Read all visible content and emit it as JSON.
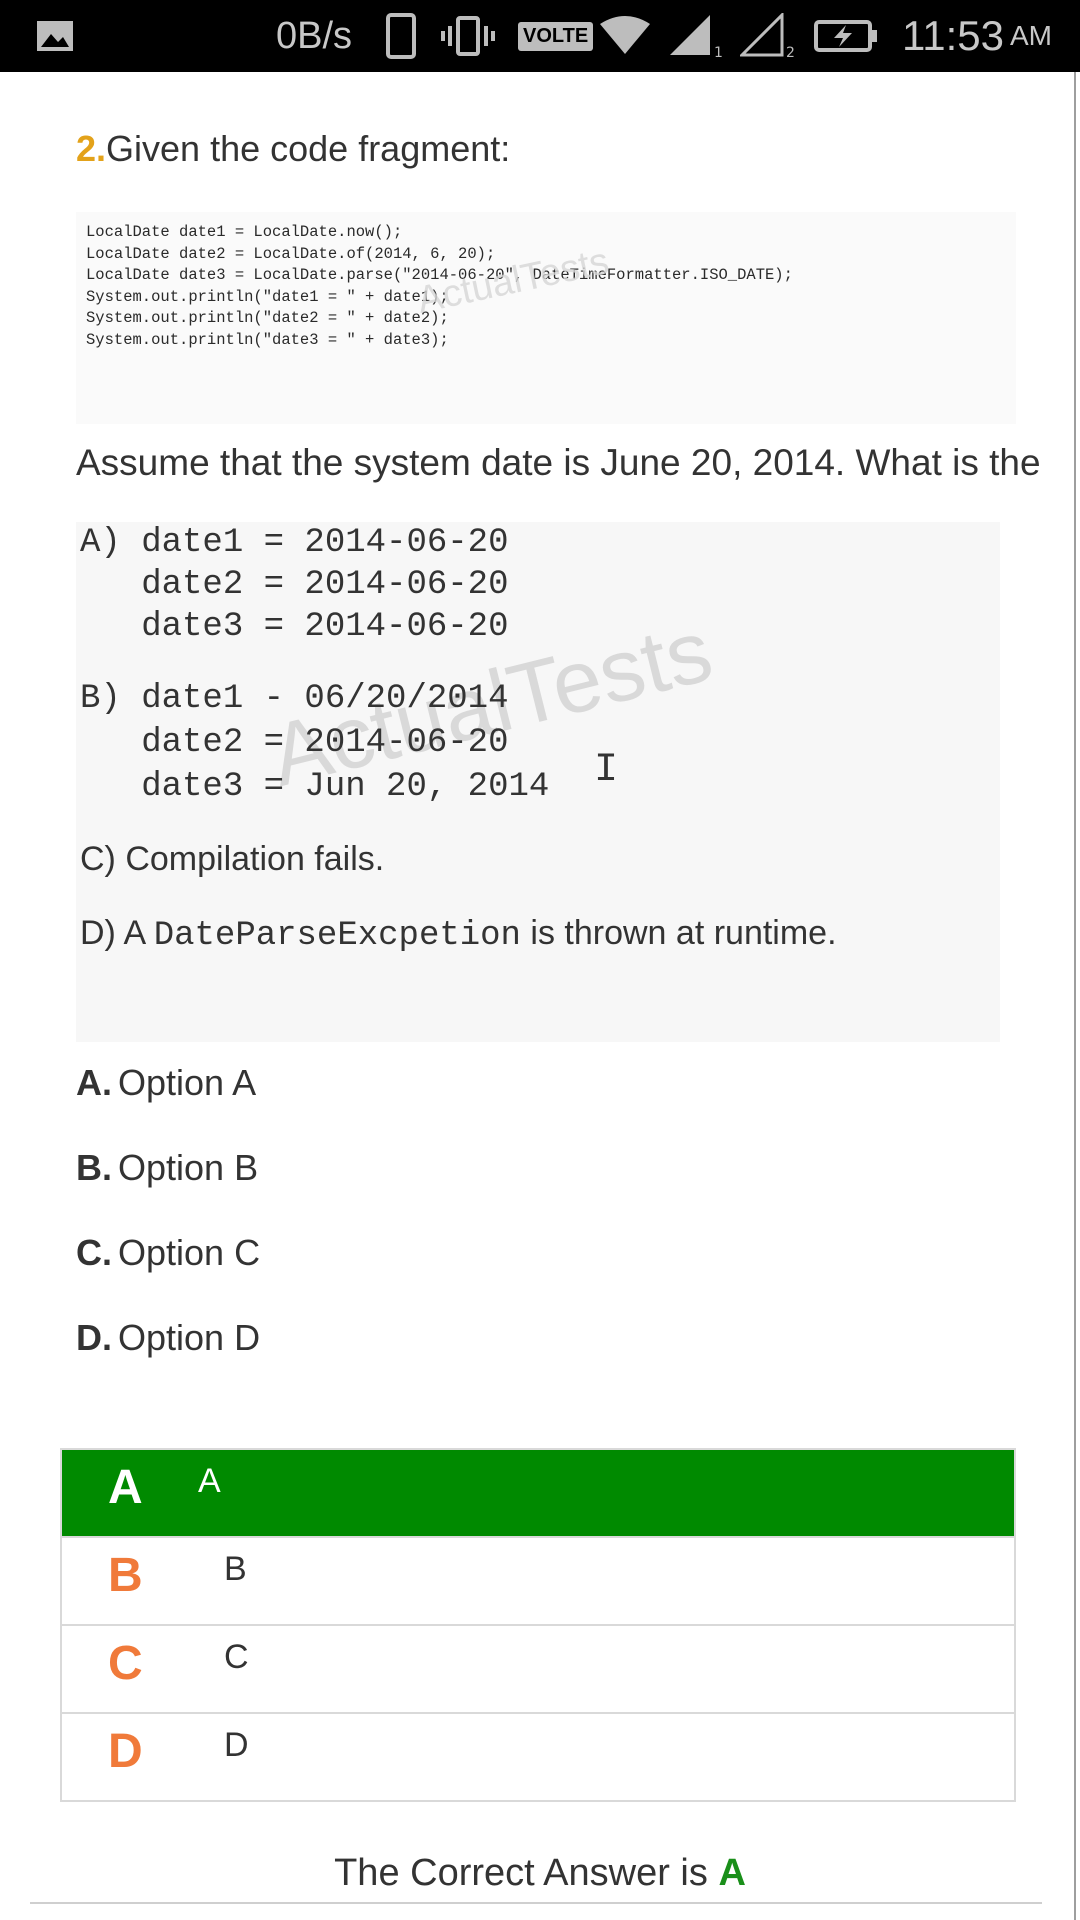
{
  "status_bar": {
    "speed": "0B/s",
    "volte": "VOLTE",
    "sim1": "1",
    "sim2": "2",
    "time": "11:53",
    "ampm": "AM",
    "icons": [
      "gallery-icon",
      "phone-icon",
      "vibrate-icon",
      "volte-icon",
      "wifi-icon",
      "signal-icon",
      "signal-icon",
      "battery-charging-icon"
    ]
  },
  "question": {
    "number": "2.",
    "title": "Given the code fragment:",
    "code_lines": [
      "LocalDate date1 = LocalDate.now();",
      "LocalDate date2 = LocalDate.of(2014, 6, 20);",
      "LocalDate date3 = LocalDate.parse(\"2014-06-20\", DateTimeFormatter.ISO_DATE);",
      "System.out.println(\"date1 = \" + date1);",
      "System.out.println(\"date2 = \" + date2);",
      "System.out.println(\"date3 = \" + date3);"
    ],
    "watermark": "ActualTests",
    "prompt": "Assume that the system date is June 20, 2014. What is the"
  },
  "option_image": {
    "a_lines": [
      "A) date1 = 2014-06-20",
      "   date2 = 2014-06-20",
      "   date3 = 2014-06-20"
    ],
    "b_lines": [
      "B) date1 - 06/20/2014",
      "   date2 = 2014-06-20",
      "   date3 = Jun 20, 2014"
    ],
    "c_line": "C) Compilation fails.",
    "d_prefix": "D) A ",
    "d_code": "DateParseExcpetion",
    "d_suffix": " is thrown at runtime.",
    "watermark": "ActualTests"
  },
  "answers": [
    {
      "letter": "A.",
      "text": "Option A"
    },
    {
      "letter": "B.",
      "text": "Option B"
    },
    {
      "letter": "C.",
      "text": "Option C"
    },
    {
      "letter": "D.",
      "text": "Option D"
    }
  ],
  "choices": [
    {
      "letter": "A",
      "text": "A"
    },
    {
      "letter": "B",
      "text": "B"
    },
    {
      "letter": "C",
      "text": "C"
    },
    {
      "letter": "D",
      "text": "D"
    }
  ],
  "result": {
    "label": "The Correct Answer is ",
    "answer": "A"
  },
  "colors": {
    "accent_number": "#e3a21a",
    "correct_row": "#008a00",
    "choice_letter": "#f07a3a",
    "correct_text": "#1a8f1a"
  }
}
